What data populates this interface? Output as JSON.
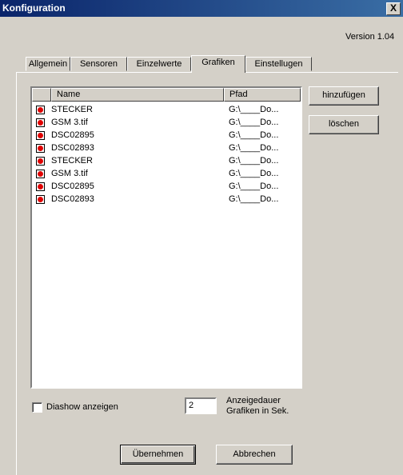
{
  "window": {
    "title": "Konfiguration",
    "close_label": "X"
  },
  "version": "Version 1.04",
  "tabs": [
    {
      "label": "Allgemein"
    },
    {
      "label": "Sensoren"
    },
    {
      "label": "Einzelwerte"
    },
    {
      "label": "Grafiken",
      "active": true
    },
    {
      "label": "Einstellugen"
    }
  ],
  "list": {
    "columns": {
      "name": "Name",
      "path": "Pfad"
    },
    "rows": [
      {
        "name": "STECKER",
        "path": "G:\\____Do..."
      },
      {
        "name": "GSM 3.tif",
        "path": "G:\\____Do..."
      },
      {
        "name": "DSC02895",
        "path": "G:\\____Do..."
      },
      {
        "name": "DSC02893",
        "path": "G:\\____Do..."
      },
      {
        "name": "STECKER",
        "path": "G:\\____Do..."
      },
      {
        "name": "GSM 3.tif",
        "path": "G:\\____Do..."
      },
      {
        "name": "DSC02895",
        "path": "G:\\____Do..."
      },
      {
        "name": "DSC02893",
        "path": "G:\\____Do..."
      }
    ]
  },
  "buttons": {
    "add": "hinzufügen",
    "delete": "löschen",
    "apply": "Übernehmen",
    "cancel": "Abbrechen"
  },
  "slideshow": {
    "checkbox_label": "Diashow anzeigen",
    "checked": false,
    "duration_value": "2",
    "duration_label_line1": "Anzeigedauer",
    "duration_label_line2": "Grafiken in Sek."
  },
  "colors": {
    "status_icon": "#e00000",
    "titlebar": "#0a246a"
  }
}
